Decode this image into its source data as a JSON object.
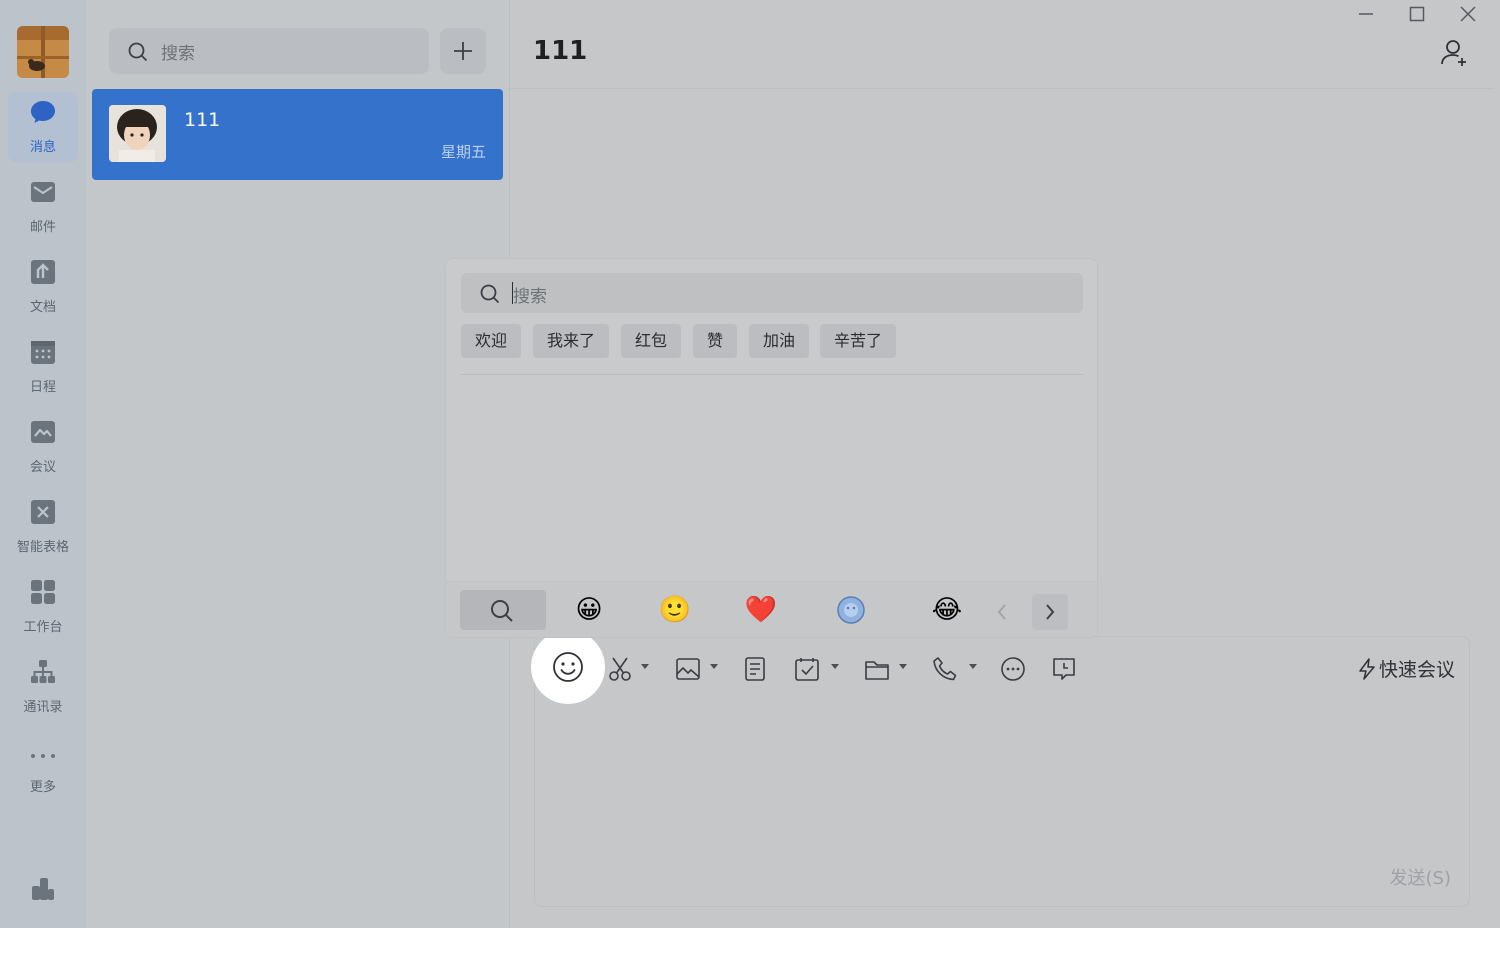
{
  "nav": {
    "items": [
      {
        "label": "消息",
        "icon": "chat-bubble-icon",
        "active": true
      },
      {
        "label": "邮件",
        "icon": "mail-icon"
      },
      {
        "label": "文档",
        "icon": "document-icon"
      },
      {
        "label": "日程",
        "icon": "calendar-icon"
      },
      {
        "label": "会议",
        "icon": "meeting-icon"
      },
      {
        "label": "智能表格",
        "icon": "smart-sheet-icon"
      },
      {
        "label": "工作台",
        "icon": "workbench-grid-icon"
      },
      {
        "label": "通讯录",
        "icon": "contacts-org-icon"
      },
      {
        "label": "更多",
        "icon": "more-dots-icon"
      }
    ],
    "bottom_icon": "stats-chart-icon"
  },
  "list": {
    "search_placeholder": "搜索",
    "conversations": [
      {
        "name": "111",
        "time": "星期五",
        "selected": true
      }
    ]
  },
  "chat": {
    "title": "111",
    "quick_meeting": "快速会议",
    "send": "发送(S)"
  },
  "sticker_popup": {
    "search_placeholder": "搜索",
    "chips": [
      "欢迎",
      "我来了",
      "红包",
      "赞",
      "加油",
      "辛苦了"
    ],
    "tabs": [
      "search-icon",
      "😀",
      "🙂",
      "❤️",
      "sticker-pack-icon",
      "😂"
    ]
  },
  "colors": {
    "accent": "#3572cb",
    "selected_conversation": "#3572cb"
  }
}
